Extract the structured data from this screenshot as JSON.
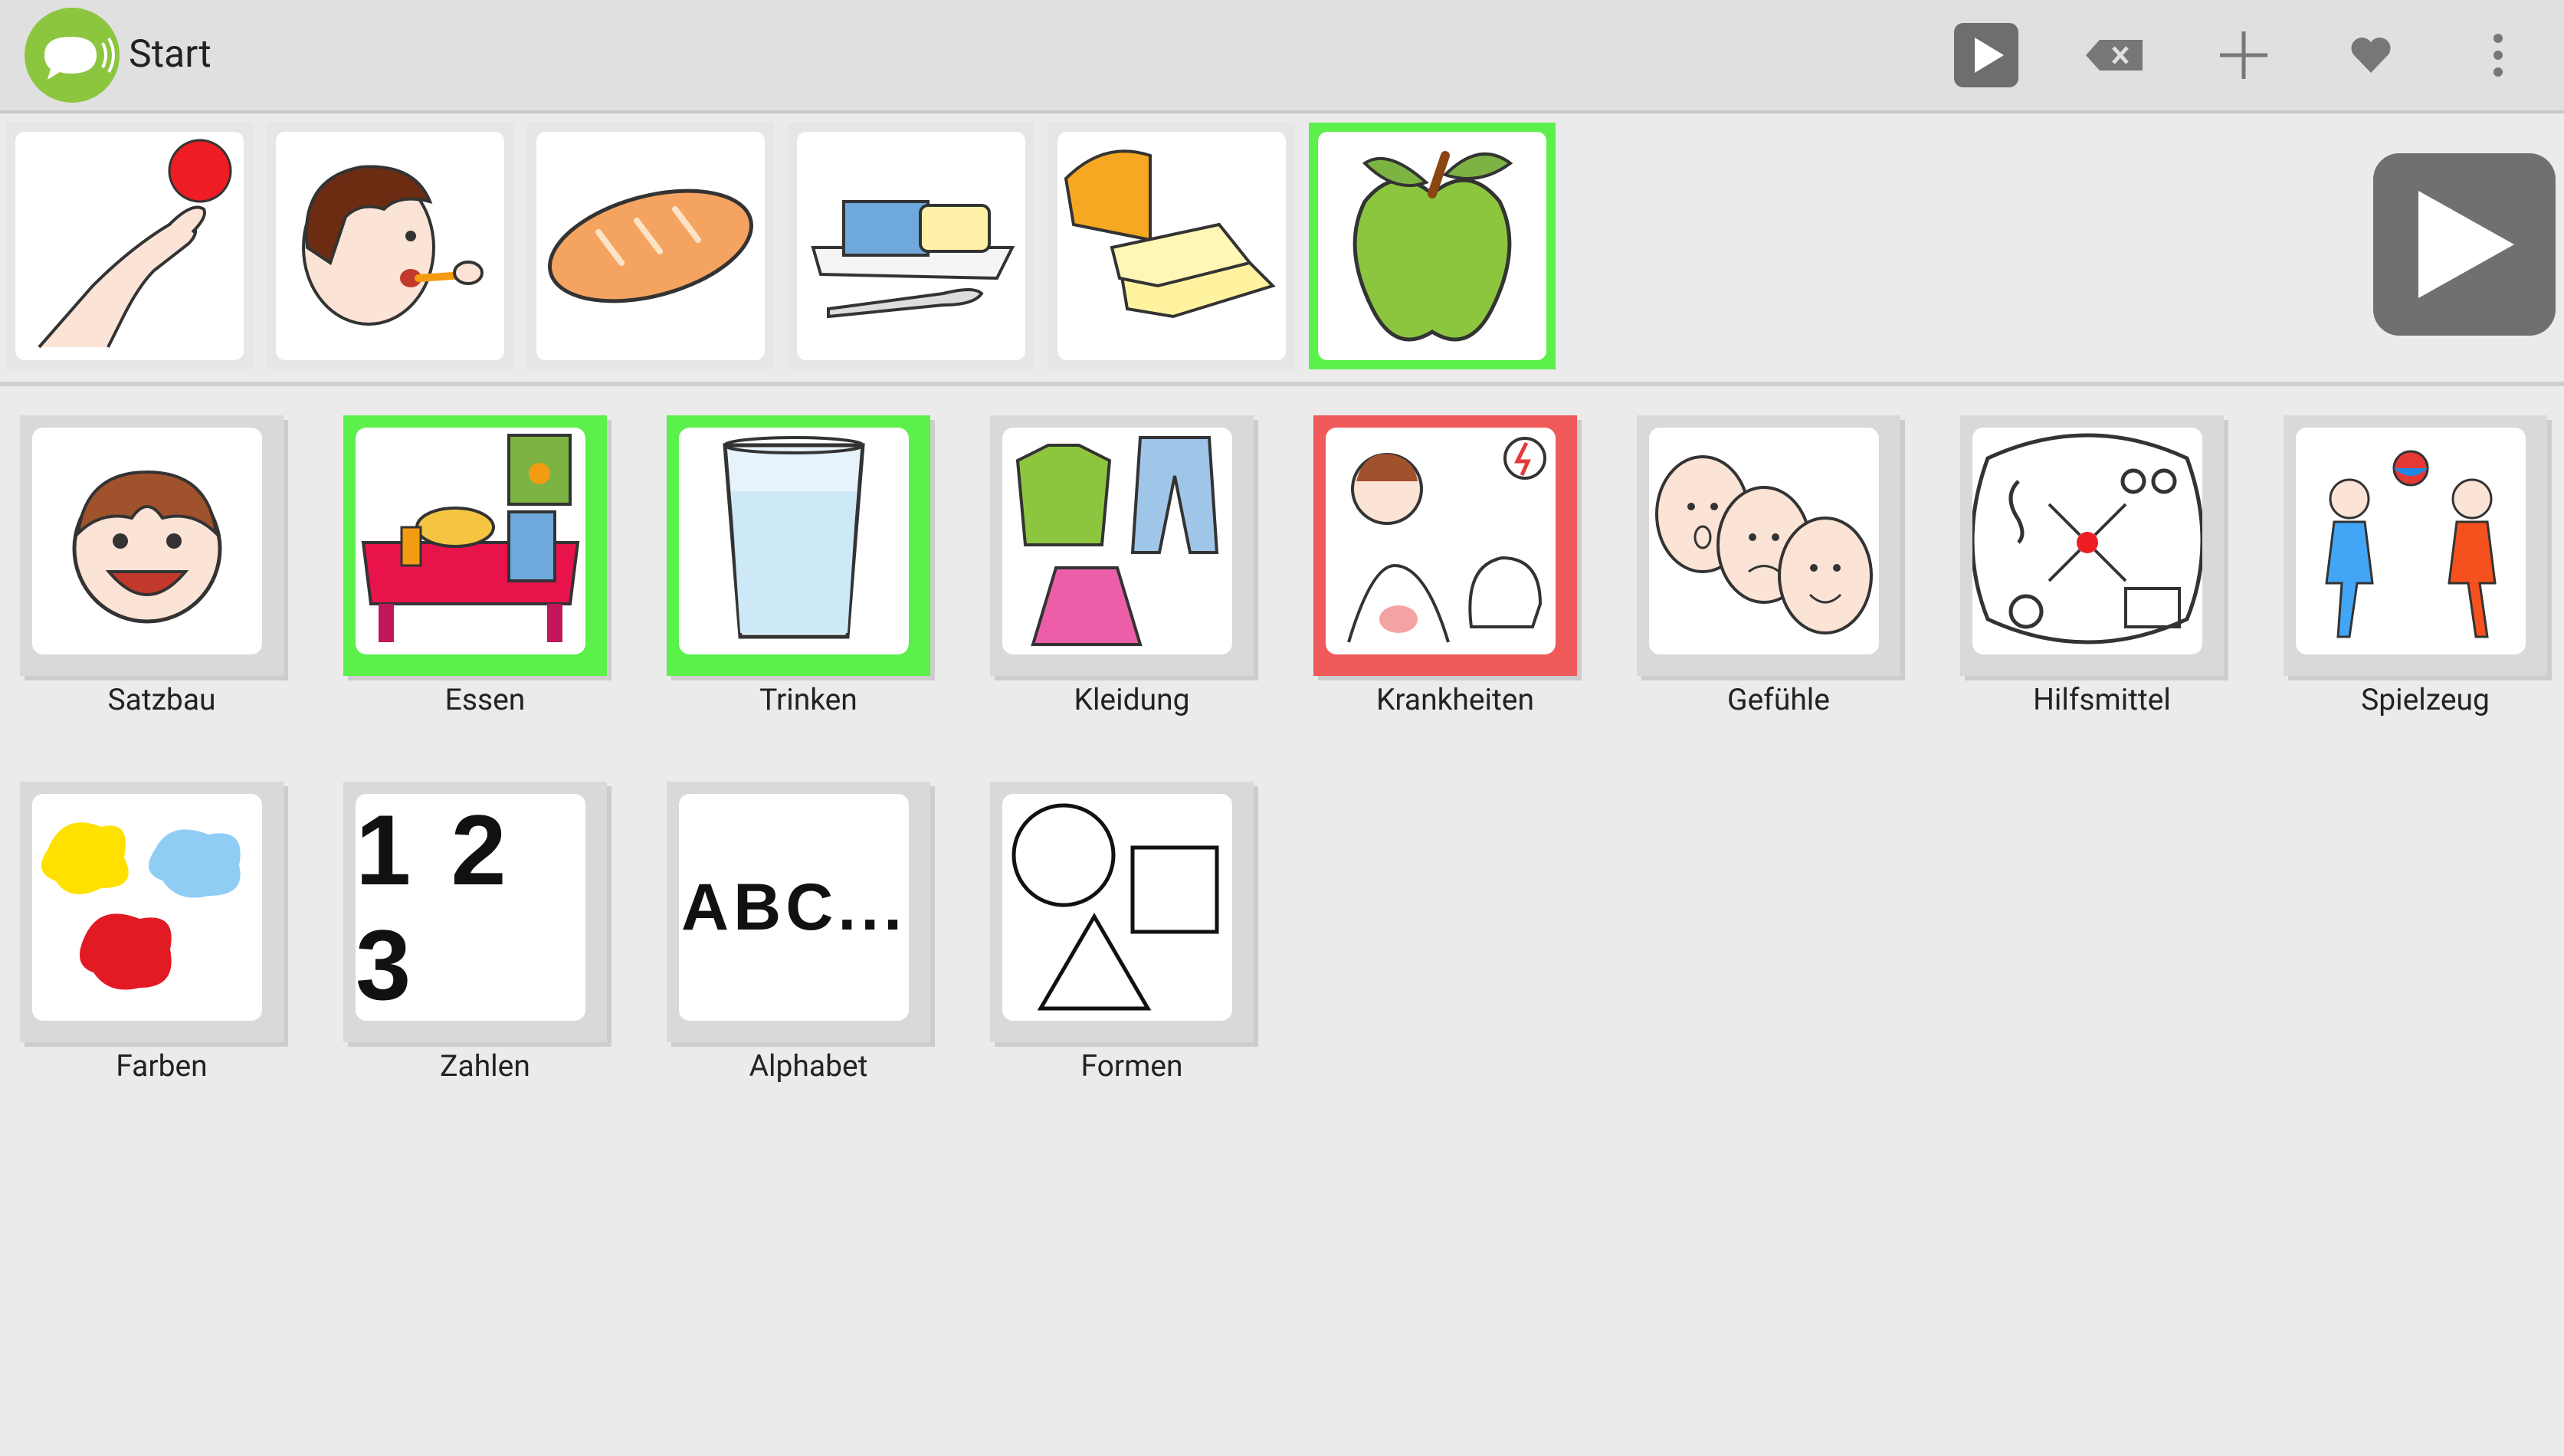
{
  "header": {
    "title": "Start",
    "actions": [
      {
        "name": "speak-button",
        "icon": "play-icon"
      },
      {
        "name": "backspace-button",
        "icon": "backspace-icon"
      },
      {
        "name": "add-button",
        "icon": "plus-icon"
      },
      {
        "name": "favorite-button",
        "icon": "heart-icon"
      },
      {
        "name": "more-button",
        "icon": "more-vertical-icon"
      }
    ]
  },
  "sentence": {
    "items": [
      {
        "symbol": "ich-hand-icon"
      },
      {
        "symbol": "essen-person-icon"
      },
      {
        "symbol": "brot-icon"
      },
      {
        "symbol": "butter-icon"
      },
      {
        "symbol": "kaese-icon"
      },
      {
        "symbol": "apfel-icon",
        "highlighted": true
      }
    ],
    "speak_icon": "play-icon"
  },
  "categories": [
    {
      "label": "Satzbau",
      "symbol": "smiling-face-icon"
    },
    {
      "label": "Essen",
      "symbol": "table-food-icon",
      "border": "green"
    },
    {
      "label": "Trinken",
      "symbol": "water-glass-icon",
      "border": "green"
    },
    {
      "label": "Kleidung",
      "symbol": "clothes-icon"
    },
    {
      "label": "Krankheiten",
      "symbol": "sick-person-icon",
      "border": "red"
    },
    {
      "label": "Gefühle",
      "symbol": "three-faces-icon"
    },
    {
      "label": "Hilfsmittel",
      "symbol": "aids-icon"
    },
    {
      "label": "Spielzeug",
      "symbol": "children-ball-icon"
    },
    {
      "label": "Farben",
      "symbol": "paint-splash-icon"
    },
    {
      "label": "Zahlen",
      "symbol": "numbers-icon",
      "glyph": "1 2 3"
    },
    {
      "label": "Alphabet",
      "symbol": "letters-icon",
      "glyph": "ABC..."
    },
    {
      "label": "Formen",
      "symbol": "shapes-icon"
    }
  ],
  "colors": {
    "accent": "#8cc63f",
    "highlight_green": "#5cf04a",
    "highlight_red": "#f05a5a",
    "button_gray": "#707070"
  }
}
